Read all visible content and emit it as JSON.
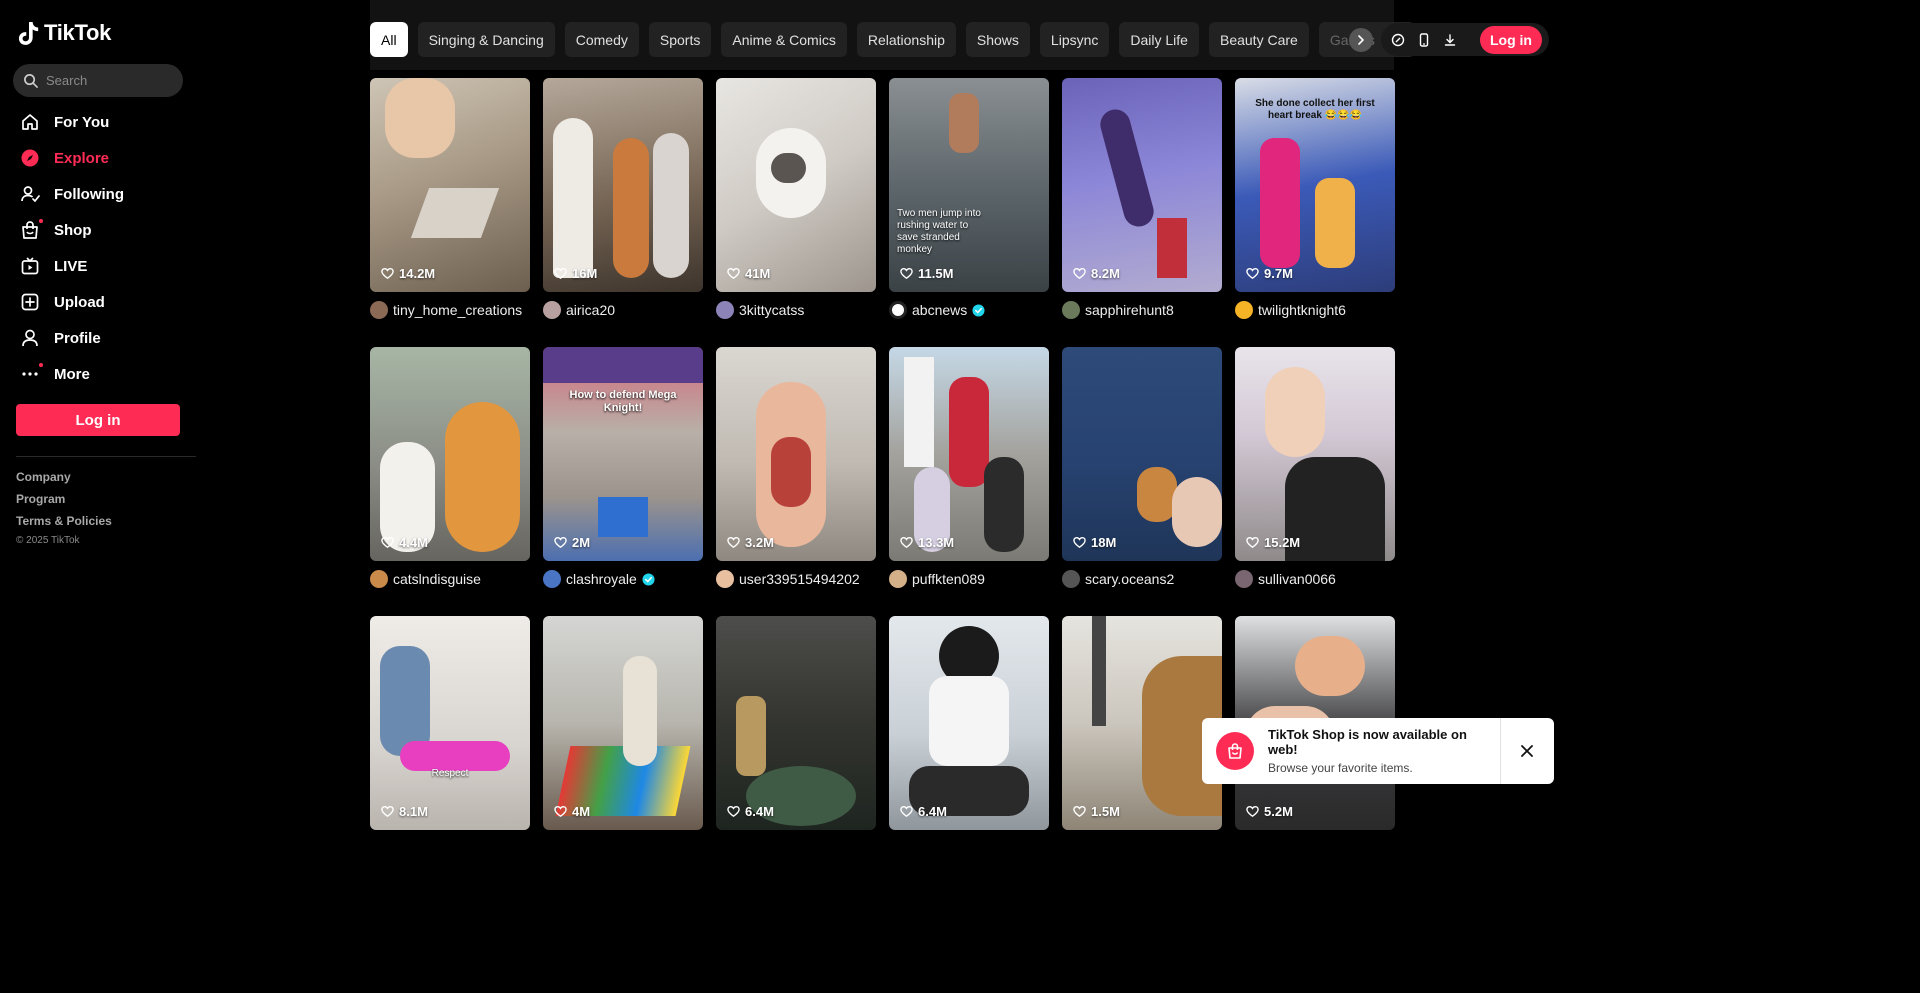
{
  "brand": {
    "name": "TikTok",
    "accent": "#fe2c55"
  },
  "search": {
    "placeholder": "Search",
    "icon": "search-icon"
  },
  "nav": [
    {
      "label": "For You",
      "icon": "home-icon",
      "active": false
    },
    {
      "label": "Explore",
      "icon": "compass-icon",
      "active": true
    },
    {
      "label": "Following",
      "icon": "following-icon",
      "active": false
    },
    {
      "label": "Shop",
      "icon": "shop-bag-icon",
      "active": false,
      "badge": true
    },
    {
      "label": "LIVE",
      "icon": "live-icon",
      "active": false
    },
    {
      "label": "Upload",
      "icon": "upload-icon",
      "active": false
    },
    {
      "label": "Profile",
      "icon": "profile-icon",
      "active": false
    },
    {
      "label": "More",
      "icon": "more-icon",
      "active": false,
      "badge": true
    }
  ],
  "sidebar_login": "Log in",
  "footer": {
    "links": [
      "Company",
      "Program",
      "Terms & Policies"
    ],
    "copyright": "© 2025 TikTok"
  },
  "categories": [
    "All",
    "Singing & Dancing",
    "Comedy",
    "Sports",
    "Anime & Comics",
    "Relationship",
    "Shows",
    "Lipsync",
    "Daily Life",
    "Beauty Care",
    "Games"
  ],
  "top_login": "Log in",
  "videos": [
    {
      "likes": "14.2M",
      "user": "tiny_home_creations",
      "verified": false
    },
    {
      "likes": "16M",
      "user": "airica20",
      "verified": false
    },
    {
      "likes": "41M",
      "user": "3kittycatss",
      "verified": false
    },
    {
      "likes": "11.5M",
      "user": "abcnews",
      "verified": true,
      "overlay": "Two men jump into rushing water to save stranded monkey"
    },
    {
      "likes": "8.2M",
      "user": "sapphirehunt8",
      "verified": false
    },
    {
      "likes": "9.7M",
      "user": "twilightknight6",
      "verified": false,
      "overlay": "She done collect her first heart break 😂😂😂"
    },
    {
      "likes": "4.4M",
      "user": "catslndisguise",
      "verified": false
    },
    {
      "likes": "2M",
      "user": "clashroyale",
      "verified": true,
      "overlay": "How to defend Mega Knight!"
    },
    {
      "likes": "3.2M",
      "user": "user339515494202",
      "verified": false
    },
    {
      "likes": "13.3M",
      "user": "puffkten089",
      "verified": false
    },
    {
      "likes": "18M",
      "user": "scary.oceans2",
      "verified": false
    },
    {
      "likes": "15.2M",
      "user": "sullivan0066",
      "verified": false
    },
    {
      "likes": "8.1M",
      "user": "",
      "verified": false,
      "overlay": "Respect"
    },
    {
      "likes": "4M",
      "user": "",
      "verified": false
    },
    {
      "likes": "6.4M",
      "user": "",
      "verified": false
    },
    {
      "likes": "6.4M",
      "user": "",
      "verified": false
    },
    {
      "likes": "1.5M",
      "user": "",
      "verified": false
    },
    {
      "likes": "5.2M",
      "user": "",
      "verified": false
    }
  ],
  "toast": {
    "title": "TikTok Shop is now available on web!",
    "subtitle": "Browse your favorite items.",
    "icon": "shop-bag-icon"
  }
}
